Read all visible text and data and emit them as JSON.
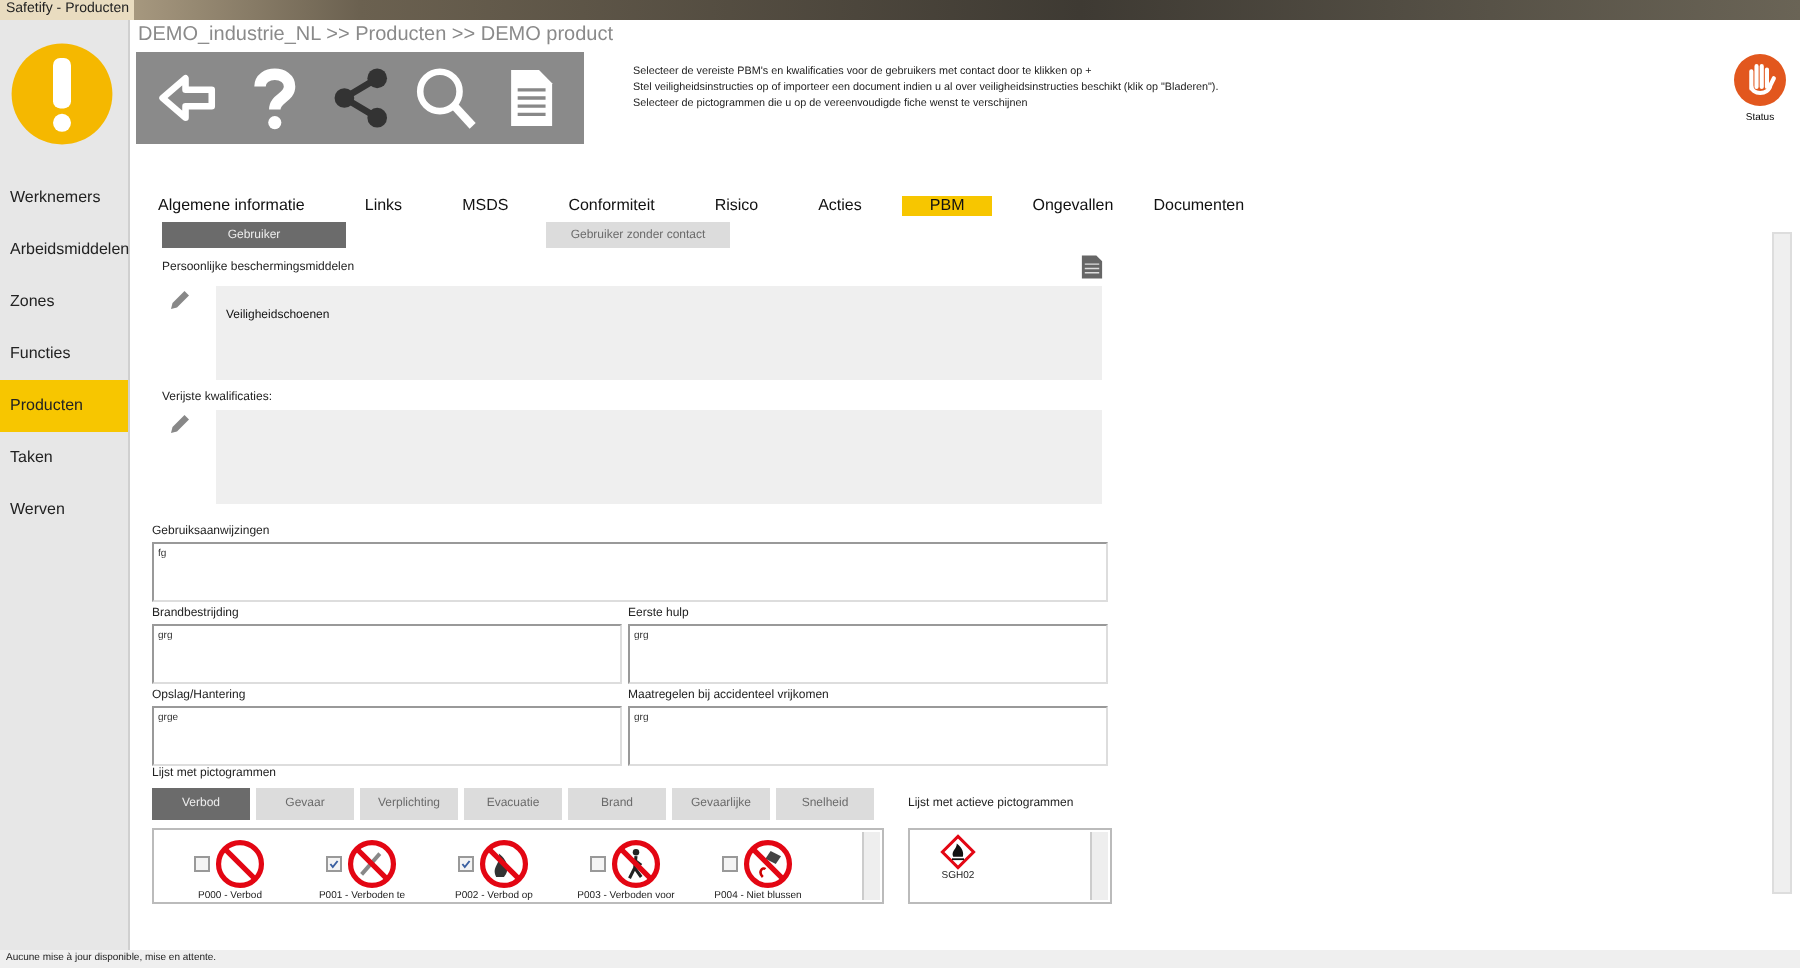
{
  "window": {
    "title": "Safetify - Producten"
  },
  "sidebar": {
    "items": [
      {
        "label": "Werknemers",
        "selected": false
      },
      {
        "label": "Arbeidsmiddelen",
        "selected": false
      },
      {
        "label": "Zones",
        "selected": false
      },
      {
        "label": "Functies",
        "selected": false
      },
      {
        "label": "Producten",
        "selected": true
      },
      {
        "label": "Taken",
        "selected": false
      },
      {
        "label": "Werven",
        "selected": false
      }
    ]
  },
  "breadcrumb": "DEMO_industrie_NL >> Producten >> DEMO product",
  "instructions": [
    "Selecteer de vereiste PBM's en kwalificaties voor de gebruikers met contact door te klikken op +",
    "Stel veiligheidsinstructies op of importeer een document indien u al over veiligheidsinstructies beschikt (klik op \"Bladeren\").",
    "Selecteer de pictogrammen die u op de vereenvoudigde fiche wenst te verschijnen"
  ],
  "status": {
    "label": "Status"
  },
  "tabs": [
    {
      "label": "Algemene informatie",
      "selected": false
    },
    {
      "label": "Links",
      "selected": false
    },
    {
      "label": "MSDS",
      "selected": false
    },
    {
      "label": "Conformiteit",
      "selected": false
    },
    {
      "label": "Risico",
      "selected": false
    },
    {
      "label": "Acties",
      "selected": false
    },
    {
      "label": "PBM",
      "selected": true
    },
    {
      "label": "Ongevallen",
      "selected": false
    },
    {
      "label": "Documenten",
      "selected": false
    }
  ],
  "user_buttons": [
    {
      "label": "Gebruiker",
      "selected": true
    },
    {
      "label": "Gebruiker zonder contact",
      "selected": false
    }
  ],
  "ppe": {
    "label": "Persoonlijke beschermingsmiddelen",
    "value": "Veiligheidschoenen"
  },
  "qualifications": {
    "label": "Verijste kwalificaties:"
  },
  "instructions_field": {
    "label": "Gebruiksaanwijzingen",
    "value": "fg"
  },
  "fields": [
    {
      "label": "Brandbestrijding",
      "value": "grg"
    },
    {
      "label": "Eerste hulp",
      "value": "grg"
    },
    {
      "label": "Opslag/Hantering",
      "value": "grge"
    },
    {
      "label": "Maatregelen bij accidenteel vrijkomen",
      "value": "grg"
    }
  ],
  "pictograms": {
    "label": "Lijst met pictogrammen",
    "categories": [
      {
        "label": "Verbod",
        "selected": true
      },
      {
        "label": "Gevaar",
        "selected": false
      },
      {
        "label": "Verplichting",
        "selected": false
      },
      {
        "label": "Evacuatie",
        "selected": false
      },
      {
        "label": "Brand",
        "selected": false
      },
      {
        "label": "Gevaarlijke",
        "selected": false
      },
      {
        "label": "Snelheid",
        "selected": false
      }
    ],
    "items": [
      {
        "label": "P000 - Verbod",
        "checked": false
      },
      {
        "label": "P001 - Verboden te",
        "checked": true
      },
      {
        "label": "P002 - Verbod op",
        "checked": true
      },
      {
        "label": "P003 - Verboden voor",
        "checked": false
      },
      {
        "label": "P004 - Niet blussen",
        "checked": false
      }
    ]
  },
  "active_pictograms": {
    "label": "Lijst met actieve pictogrammen",
    "items": [
      {
        "label": "SGH02"
      }
    ]
  },
  "status_bar": "Aucune mise à jour disponible, mise en attente."
}
